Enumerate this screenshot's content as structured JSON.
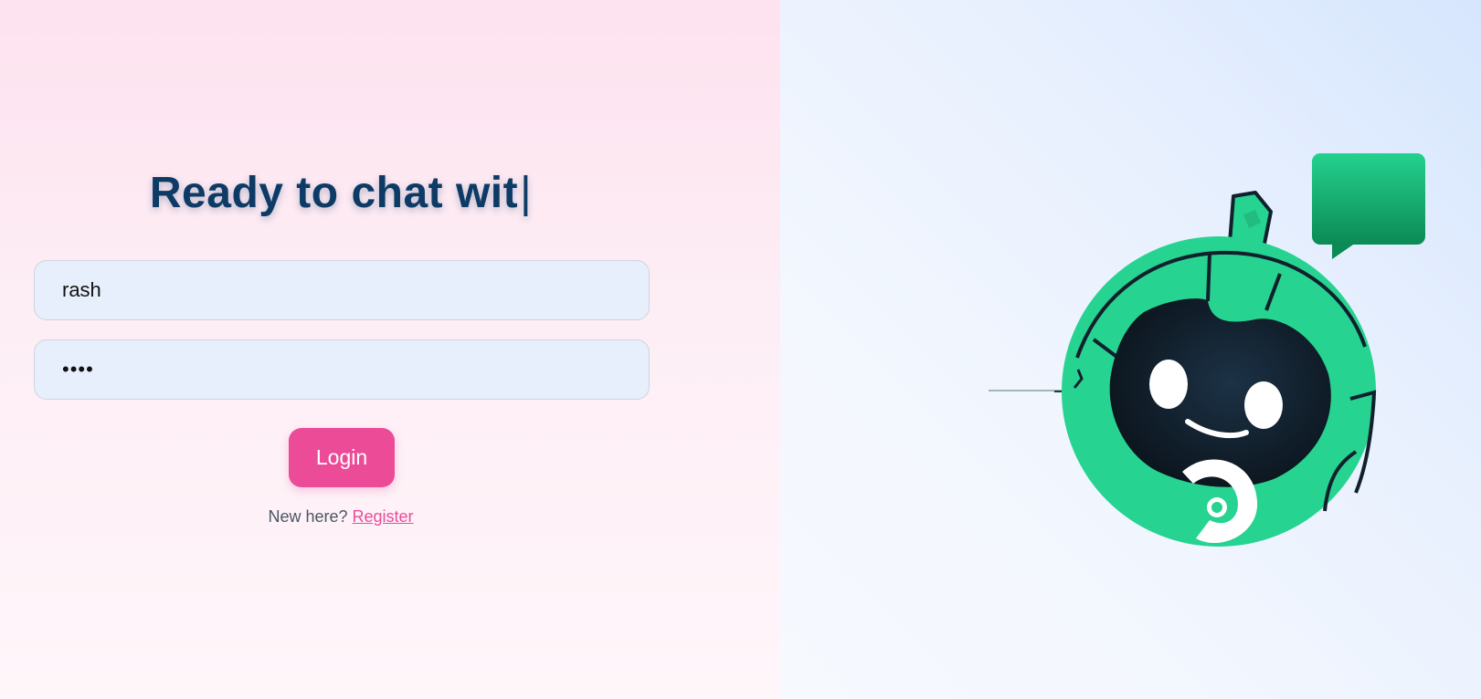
{
  "login": {
    "headline": "Ready to chat wit",
    "caret": "|",
    "username_value": "rash",
    "password_value": "••••",
    "login_button": "Login",
    "register_prompt": "New here?",
    "register_link": "Register"
  },
  "colors": {
    "headline": "#0e3b66",
    "accent": "#ec4b98",
    "field_background": "#e8effc",
    "robot_green": "#27d391",
    "robot_face": "#0f1a24"
  },
  "illustration": {
    "subject": "robot-mascot-icon",
    "bubble": "chat-bubble-icon"
  }
}
